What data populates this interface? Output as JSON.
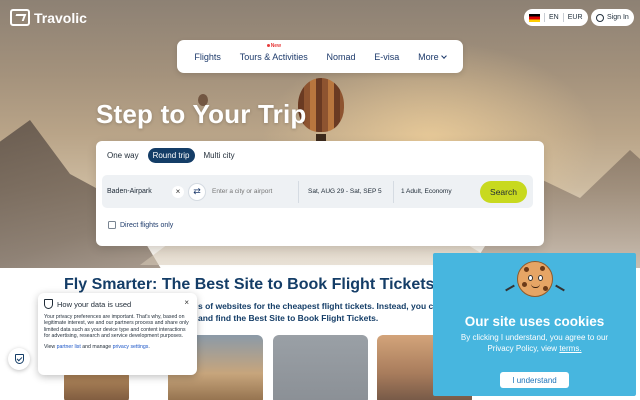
{
  "brand": {
    "name": "Travolic"
  },
  "header": {
    "lang_code": "EN",
    "currency": "EUR",
    "signin_label": "Sign In"
  },
  "nav": {
    "items": [
      {
        "label": "Flights"
      },
      {
        "label": "Tours & Activities",
        "badge": "New"
      },
      {
        "label": "Nomad"
      },
      {
        "label": "E-visa"
      },
      {
        "label": "More"
      }
    ]
  },
  "hero": {
    "title": "Step to Your Trip"
  },
  "search": {
    "trip_types": [
      "One way",
      "Round trip",
      "Multi city"
    ],
    "active_trip_type": "Round trip",
    "from_value": "Baden-Airpark",
    "to_placeholder": "Enter a city or airport",
    "dates": "Sat, AUG 29 - Sat, SEP 5",
    "passengers": "1 Adult, Economy",
    "search_label": "Search",
    "direct_only_label": "Direct flights only"
  },
  "content": {
    "section_title": "Fly Smarter: The Best Site to Book Flight Tickets at Y",
    "section_text_line1": "s of websites for the cheapest flight tickets. Instead, you c",
    "section_text_line2": "and find the Best Site to Book Flight Tickets."
  },
  "privacy": {
    "title": "How your data is used",
    "close": "×",
    "body": "Your privacy preferences are important. That's why, based on legitimate interest, we and our partners process and share only limited data such as your device type and content interactions for advertising, research and service development purposes.",
    "links_prefix": "View",
    "partner_link": "partner list",
    "links_mid": "and manage",
    "settings_link": "privacy settings",
    "links_suffix": "."
  },
  "cookie": {
    "title": "Our site uses cookies",
    "text": "By clicking I understand, you agree to our Privacy Policy, view",
    "terms_link": "terms.",
    "button_label": "I understand"
  },
  "colors": {
    "primary_navy": "#143d67",
    "accent_lime": "#c8d91f",
    "cookie_blue": "#47b6df"
  }
}
